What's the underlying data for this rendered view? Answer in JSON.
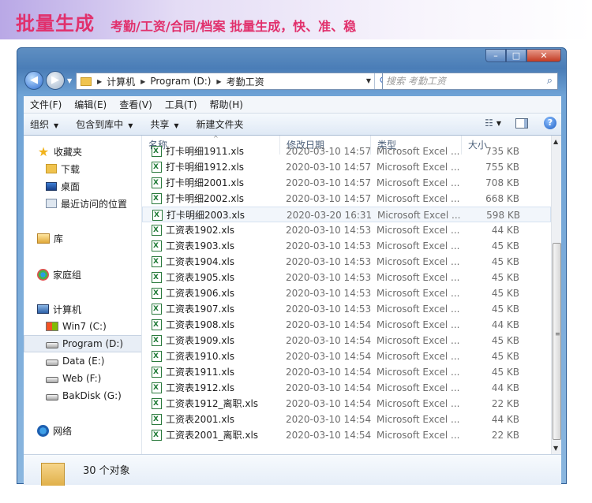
{
  "banner": {
    "title": "批量生成",
    "subtitle": "考勤/工资/合同/档案 批量生成，快、准、稳"
  },
  "window": {
    "caption_buttons": {
      "minimize": "–",
      "maximize": "□",
      "close": "✕"
    }
  },
  "address": {
    "breadcrumbs": [
      "计算机",
      "Program (D:)",
      "考勤工资"
    ],
    "search_placeholder": "搜索 考勤工资"
  },
  "menu": [
    "文件(F)",
    "编辑(E)",
    "查看(V)",
    "工具(T)",
    "帮助(H)"
  ],
  "commands": {
    "organize": "组织",
    "include_library": "包含到库中",
    "share": "共享",
    "new_folder": "新建文件夹"
  },
  "nav": {
    "favorites": "收藏夹",
    "downloads": "下载",
    "desktop": "桌面",
    "recent": "最近访问的位置",
    "libraries": "库",
    "homegroup": "家庭组",
    "computer": "计算机",
    "drives": [
      "Win7 (C:)",
      "Program (D:)",
      "Data (E:)",
      "Web (F:)",
      "BakDisk (G:)"
    ],
    "network": "网络"
  },
  "columns": {
    "name": "名称",
    "modified": "修改日期",
    "type": "类型",
    "size": "大小"
  },
  "files": [
    {
      "name": "打卡明细1911.xls",
      "modified": "2020-03-10 14:57",
      "type": "Microsoft Excel ...",
      "size": "735 KB"
    },
    {
      "name": "打卡明细1912.xls",
      "modified": "2020-03-10 14:57",
      "type": "Microsoft Excel ...",
      "size": "755 KB"
    },
    {
      "name": "打卡明细2001.xls",
      "modified": "2020-03-10 14:57",
      "type": "Microsoft Excel ...",
      "size": "708 KB"
    },
    {
      "name": "打卡明细2002.xls",
      "modified": "2020-03-10 14:57",
      "type": "Microsoft Excel ...",
      "size": "668 KB"
    },
    {
      "name": "打卡明细2003.xls",
      "modified": "2020-03-20 16:31",
      "type": "Microsoft Excel ...",
      "size": "598 KB"
    },
    {
      "name": "工资表1902.xls",
      "modified": "2020-03-10 14:53",
      "type": "Microsoft Excel ...",
      "size": "44 KB"
    },
    {
      "name": "工资表1903.xls",
      "modified": "2020-03-10 14:53",
      "type": "Microsoft Excel ...",
      "size": "45 KB"
    },
    {
      "name": "工资表1904.xls",
      "modified": "2020-03-10 14:53",
      "type": "Microsoft Excel ...",
      "size": "45 KB"
    },
    {
      "name": "工资表1905.xls",
      "modified": "2020-03-10 14:53",
      "type": "Microsoft Excel ...",
      "size": "45 KB"
    },
    {
      "name": "工资表1906.xls",
      "modified": "2020-03-10 14:53",
      "type": "Microsoft Excel ...",
      "size": "45 KB"
    },
    {
      "name": "工资表1907.xls",
      "modified": "2020-03-10 14:53",
      "type": "Microsoft Excel ...",
      "size": "45 KB"
    },
    {
      "name": "工资表1908.xls",
      "modified": "2020-03-10 14:54",
      "type": "Microsoft Excel ...",
      "size": "44 KB"
    },
    {
      "name": "工资表1909.xls",
      "modified": "2020-03-10 14:54",
      "type": "Microsoft Excel ...",
      "size": "45 KB"
    },
    {
      "name": "工资表1910.xls",
      "modified": "2020-03-10 14:54",
      "type": "Microsoft Excel ...",
      "size": "45 KB"
    },
    {
      "name": "工资表1911.xls",
      "modified": "2020-03-10 14:54",
      "type": "Microsoft Excel ...",
      "size": "45 KB"
    },
    {
      "name": "工资表1912.xls",
      "modified": "2020-03-10 14:54",
      "type": "Microsoft Excel ...",
      "size": "44 KB"
    },
    {
      "name": "工资表1912_离职.xls",
      "modified": "2020-03-10 14:54",
      "type": "Microsoft Excel ...",
      "size": "22 KB"
    },
    {
      "name": "工资表2001.xls",
      "modified": "2020-03-10 14:54",
      "type": "Microsoft Excel ...",
      "size": "44 KB"
    },
    {
      "name": "工资表2001_离职.xls",
      "modified": "2020-03-10 14:54",
      "type": "Microsoft Excel ...",
      "size": "22 KB"
    }
  ],
  "status": {
    "item_count": "30 个对象"
  },
  "colors": {
    "banner_text": "#e1306c",
    "selection": "#e8eef6",
    "window_frame": "#4a7db7"
  }
}
